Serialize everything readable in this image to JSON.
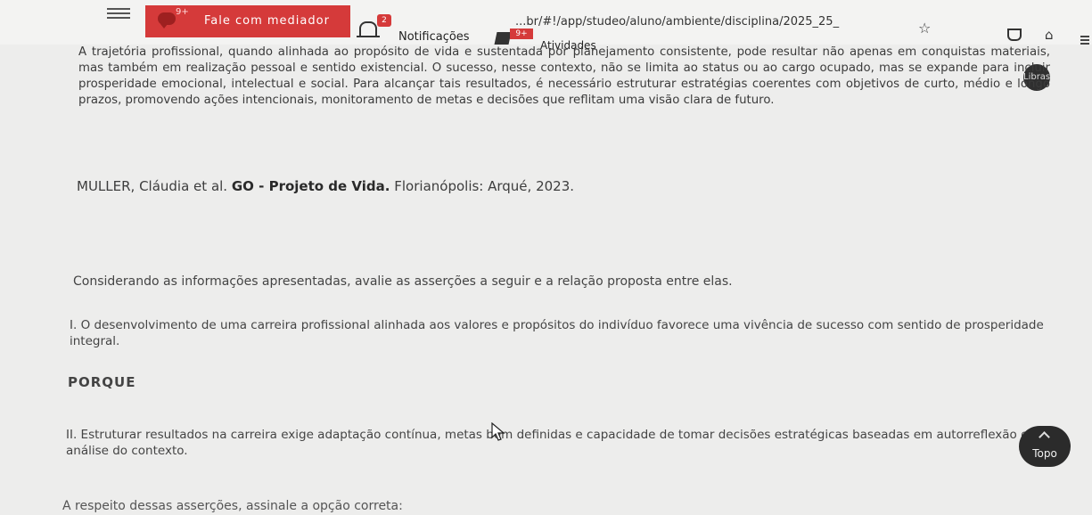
{
  "header": {
    "url": "...br/#!/app/studeo/aluno/ambiente/disciplina/2025_25_",
    "mediator_label": "Fale com mediador",
    "mediator_badge": "9+",
    "notifications_label": "Notificações",
    "notifications_badge": "2",
    "activities_label": "Atividades",
    "activities_badge": "9+",
    "icons": [
      "menu-icon",
      "chat-icon",
      "bell-icon",
      "book-icon",
      "star-icon",
      "pocket-icon",
      "home-icon",
      "browser-menu-icon",
      "accessibility-icon"
    ]
  },
  "content": {
    "paragraph": "A trajetória profissional, quando alinhada ao propósito de vida e sustentada por planejamento consistente, pode resultar não apenas em conquistas materiais, mas também em realização pessoal e sentido existencial. O sucesso, nesse contexto, não se limita ao status ou ao cargo ocupado, mas se expande para incluir prosperidade emocional, intelectual e social. Para alcançar tais resultados, é necessário estruturar estratégias coerentes com objetivos de curto, médio e longo prazos, promovendo ações intencionais, monitoramento de metas e decisões que reflitam uma visão clara de futuro.",
    "reference_authors": "MULLER, Cláudia et al.",
    "reference_title": "GO - Projeto de Vida.",
    "reference_publisher": "Florianópolis: Arqué, 2023.",
    "instruction": "Considerando as informações apresentadas, avalie as asserções a seguir e a relação proposta entre elas.",
    "assertion_1": "I. O desenvolvimento de uma carreira profissional alinhada aos valores e propósitos do indivíduo favorece uma vivência de sucesso com sentido de prosperidade integral.",
    "connector": "PORQUE",
    "assertion_2": "II. Estruturar resultados na carreira exige adaptação contínua, metas bem definidas e capacidade de tomar decisões estratégicas baseadas em autorreflexão e análise do contexto.",
    "question": "A respeito dessas asserções, assinale a opção correta:"
  },
  "floating": {
    "top_button_label": "Topo",
    "accessibility_label": "Libras"
  }
}
